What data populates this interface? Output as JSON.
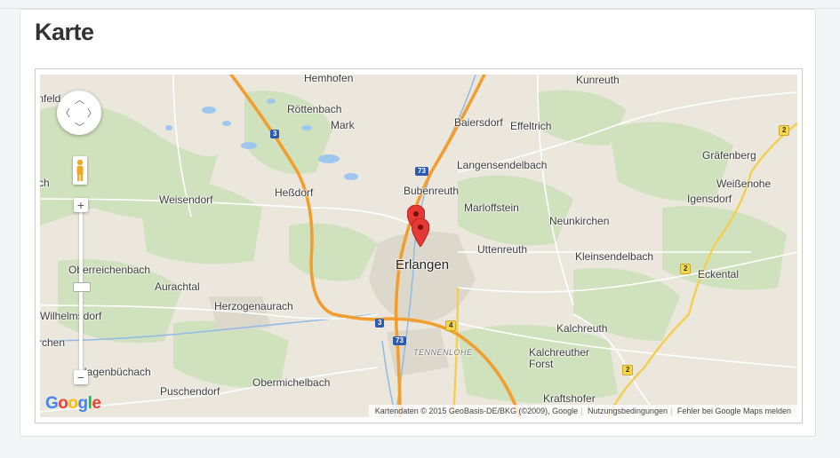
{
  "page": {
    "title": "Karte"
  },
  "map": {
    "places": [
      {
        "key": "hemhofen",
        "label": "Hemhofen"
      },
      {
        "key": "roettenbach",
        "label": "Röttenbach"
      },
      {
        "key": "mark",
        "label": "Mark"
      },
      {
        "key": "baiersdorf",
        "label": "Baiersdorf"
      },
      {
        "key": "kunreuth",
        "label": "Kunreuth"
      },
      {
        "key": "effeltrich",
        "label": "Effeltrich"
      },
      {
        "key": "langensendelbach",
        "label": "Langensendelbach"
      },
      {
        "key": "graefenberg",
        "label": "Gräfenberg"
      },
      {
        "key": "weissenohe",
        "label": "Weißenohe"
      },
      {
        "key": "igensdorf",
        "label": "Igensdorf"
      },
      {
        "key": "weisendorf",
        "label": "Weisendorf"
      },
      {
        "key": "hessdorf",
        "label": "Heßdorf"
      },
      {
        "key": "bubenreuth",
        "label": "Bubenreuth"
      },
      {
        "key": "marloffstein",
        "label": "Marloffstein"
      },
      {
        "key": "neunkirchen",
        "label": "Neunkirchen"
      },
      {
        "key": "uttenreuth",
        "label": "Uttenreuth"
      },
      {
        "key": "erlangen",
        "label": "Erlangen"
      },
      {
        "key": "kleinsendelbach",
        "label": "Kleinsendelbach"
      },
      {
        "key": "eckental",
        "label": "Eckental"
      },
      {
        "key": "oberreichenbach",
        "label": "Oberreichenbach"
      },
      {
        "key": "aurachtal",
        "label": "Aurachtal"
      },
      {
        "key": "herzogenaurach",
        "label": "Herzogenaurach"
      },
      {
        "key": "wilhelmsdorf",
        "label": "Wilhelmsdorf"
      },
      {
        "key": "kalchreuth",
        "label": "Kalchreuth"
      },
      {
        "key": "tennenlohe",
        "label": "TENNENLOHE"
      },
      {
        "key": "kalchreuther_forst",
        "label": "Kalchreuther\nForst"
      },
      {
        "key": "hagenbuechach",
        "label": "Hagenbüchach"
      },
      {
        "key": "puschendorf",
        "label": "Puschendorf"
      },
      {
        "key": "obermichelbach",
        "label": "Obermichelbach"
      },
      {
        "key": "kraftshofer",
        "label": "Kraftshofer"
      },
      {
        "key": "unfelden",
        "label": "ınfeld"
      },
      {
        "key": "chen",
        "label": "ch"
      },
      {
        "key": "rchen",
        "label": "rchen"
      }
    ],
    "shields": [
      {
        "key": "a3_top",
        "label": "3",
        "style": "blue"
      },
      {
        "key": "a73_top",
        "label": "73",
        "style": "blue"
      },
      {
        "key": "a3_bottom",
        "label": "3",
        "style": "blue"
      },
      {
        "key": "a73_bottom",
        "label": "73",
        "style": "blue"
      },
      {
        "key": "b2_right",
        "label": "2",
        "style": "yellow"
      },
      {
        "key": "b2_mid",
        "label": "2",
        "style": "yellow"
      },
      {
        "key": "b4",
        "label": "4",
        "style": "yellow"
      },
      {
        "key": "b2_bottom",
        "label": "2",
        "style": "yellow"
      }
    ],
    "google_logo": "Google",
    "attribution": {
      "data": "Kartendaten © 2015 GeoBasis-DE/BKG (©2009), Google",
      "terms": "Nutzungsbedingungen",
      "report": "Fehler bei Google Maps melden"
    },
    "controls": {
      "zoom_in": "+",
      "zoom_out": "−"
    },
    "colors": {
      "highway": "#f0a23a",
      "water": "#7fb4e8",
      "forest": "#c9dfb6",
      "pin": "#e53935"
    }
  }
}
